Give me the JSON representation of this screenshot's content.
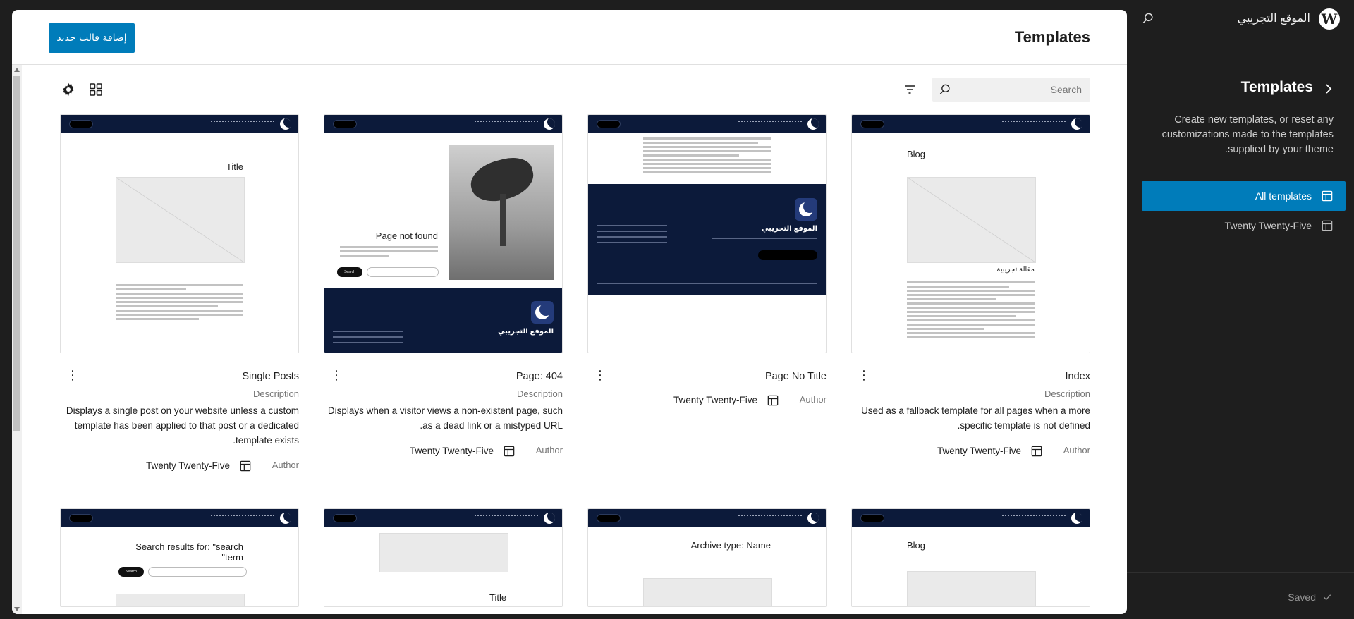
{
  "site": {
    "title": "الموقع التجريبي",
    "logo_letter": "W"
  },
  "sidebar": {
    "title": "Templates",
    "description": "Create new templates, or reset any customizations made to the templates supplied by your theme.",
    "items": [
      {
        "label": "All templates",
        "active": true
      },
      {
        "label": "Twenty Twenty-Five",
        "active": false
      }
    ],
    "saved_label": "Saved"
  },
  "header": {
    "title": "Templates",
    "add_button": "إضافة قالب جديد"
  },
  "search": {
    "placeholder": "Search"
  },
  "labels": {
    "description": "Description",
    "author": "Author"
  },
  "cards": [
    {
      "title": "Index",
      "description": "Used as a fallback template for all pages when a more specific template is not defined.",
      "author": "Twenty Twenty-Five",
      "preview_heading": "Blog",
      "preview_subheading": "مقالة تجريبية"
    },
    {
      "title": "Page No Title",
      "description": "",
      "author": "Twenty Twenty-Five",
      "preview_heading": "الموقع التجريبي"
    },
    {
      "title": "Page: 404",
      "description": "Displays when a visitor views a non-existent page, such as a dead link or a mistyped URL.",
      "author": "Twenty Twenty-Five",
      "preview_heading": "Page not found",
      "preview_footer": "الموقع التجريبي",
      "preview_button": "Search"
    },
    {
      "title": "Single Posts",
      "description": "Displays a single post on your website unless a custom template has been applied to that post or a dedicated template exists.",
      "author": "Twenty Twenty-Five",
      "preview_heading": "Title"
    },
    {
      "title": "",
      "preview_heading": "Blog"
    },
    {
      "title": "",
      "preview_heading": "Archive type: Name"
    },
    {
      "title": "",
      "preview_heading": "Title"
    },
    {
      "title": "",
      "preview_heading": "Search results for: \"search term\"",
      "preview_button": "Search"
    }
  ],
  "icons": {
    "accent": "#007cba",
    "header_bg": "#0c1a3a"
  }
}
